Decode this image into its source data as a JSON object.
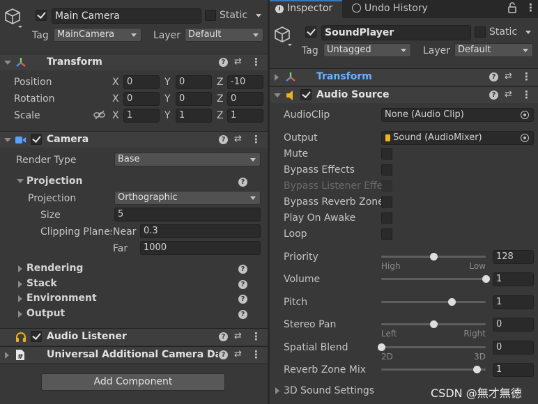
{
  "left": {
    "object": {
      "name": "Main Camera",
      "static_label": "Static",
      "tag_label": "Tag",
      "tag_value": "MainCamera",
      "layer_label": "Layer",
      "layer_value": "Default"
    },
    "transform": {
      "title": "Transform",
      "rows": [
        {
          "label": "Position",
          "x": "0",
          "y": "0",
          "z": "-10"
        },
        {
          "label": "Rotation",
          "x": "0",
          "y": "0",
          "z": "0"
        },
        {
          "label": "Scale",
          "x": "1",
          "y": "1",
          "z": "1"
        }
      ],
      "axis_x": "X",
      "axis_y": "Y",
      "axis_z": "Z"
    },
    "camera": {
      "title": "Camera",
      "render_type_label": "Render Type",
      "render_type_value": "Base",
      "projection_header": "Projection",
      "projection_label": "Projection",
      "projection_value": "Orthographic",
      "size_label": "Size",
      "size_value": "5",
      "clipping_label": "Clipping Planes",
      "near_label": "Near",
      "near_value": "0.3",
      "far_label": "Far",
      "far_value": "1000",
      "sections": [
        "Rendering",
        "Stack",
        "Environment",
        "Output"
      ]
    },
    "audio_listener": {
      "title": "Audio Listener"
    },
    "additional": {
      "title": "Universal Additional Camera Data ("
    },
    "add_component": "Add Component"
  },
  "right": {
    "tabs": {
      "inspector": "Inspector",
      "undo": "Undo History"
    },
    "object": {
      "name": "SoundPlayer",
      "static_label": "Static",
      "tag_label": "Tag",
      "tag_value": "Untagged",
      "layer_label": "Layer",
      "layer_value": "Default"
    },
    "transform": {
      "title": "Transform"
    },
    "audio_source": {
      "title": "Audio Source",
      "audioclip_label": "AudioClip",
      "audioclip_value": "None (Audio Clip)",
      "output_label": "Output",
      "output_value": "Sound (AudioMixer)",
      "toggles": [
        {
          "label": "Mute",
          "checked": false,
          "disabled": false
        },
        {
          "label": "Bypass Effects",
          "checked": false,
          "disabled": false
        },
        {
          "label": "Bypass Listener Effe",
          "checked": false,
          "disabled": true
        },
        {
          "label": "Bypass Reverb Zone",
          "checked": false,
          "disabled": false
        },
        {
          "label": "Play On Awake",
          "checked": false,
          "disabled": false
        },
        {
          "label": "Loop",
          "checked": false,
          "disabled": false
        }
      ],
      "sliders": [
        {
          "label": "Priority",
          "value": "128",
          "fraction": 0.5,
          "left_hint": "High",
          "right_hint": "Low"
        },
        {
          "label": "Volume",
          "value": "1",
          "fraction": 1.0,
          "left_hint": "",
          "right_hint": ""
        },
        {
          "label": "Pitch",
          "value": "1",
          "fraction": 0.67,
          "left_hint": "",
          "right_hint": ""
        },
        {
          "label": "Stereo Pan",
          "value": "0",
          "fraction": 0.5,
          "left_hint": "Left",
          "right_hint": "Right"
        },
        {
          "label": "Spatial Blend",
          "value": "0",
          "fraction": 0.0,
          "left_hint": "2D",
          "right_hint": "3D"
        },
        {
          "label": "Reverb Zone Mix",
          "value": "1",
          "fraction": 0.91,
          "left_hint": "",
          "right_hint": ""
        }
      ],
      "sound3d": "3D Sound Settings"
    },
    "watermark": "CSDN @無才無德"
  },
  "colors": {
    "panel_bg": "#383838",
    "field_bg": "#2a2a2a",
    "link_blue": "#6fb0ff",
    "text": "#c4c4c4"
  }
}
